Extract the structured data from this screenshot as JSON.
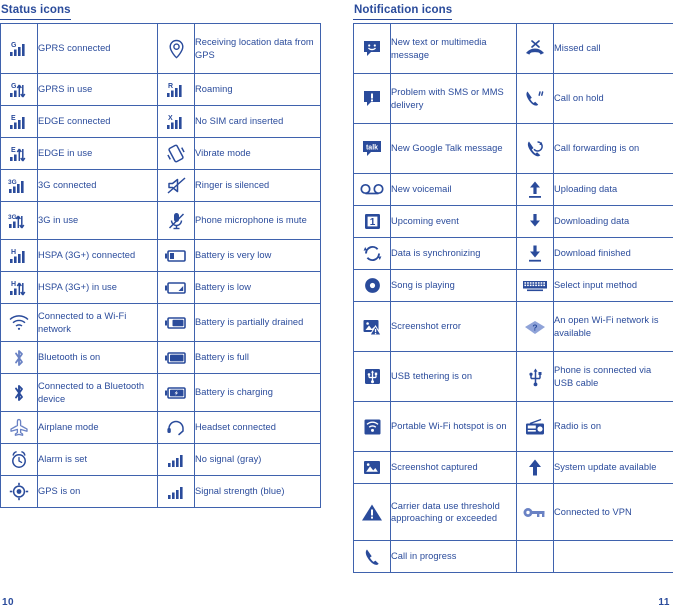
{
  "page": {
    "left_page_number": "10",
    "right_page_number": "11"
  },
  "status_section": {
    "title": "Status icons",
    "rows": [
      {
        "left": {
          "icon": "signal-bars-g-icon",
          "label": "GPRS connected"
        },
        "right": {
          "icon": "location-pin-icon",
          "label": "Receiving location data from GPS"
        }
      },
      {
        "left": {
          "icon": "signal-bars-g-active-icon",
          "label": "GPRS in use"
        },
        "right": {
          "icon": "signal-bars-r-icon",
          "label": "Roaming"
        }
      },
      {
        "left": {
          "icon": "signal-bars-e-icon",
          "label": "EDGE connected"
        },
        "right": {
          "icon": "signal-bars-x-icon",
          "label": "No SIM card inserted"
        }
      },
      {
        "left": {
          "icon": "signal-bars-e-active-icon",
          "label": "EDGE in use"
        },
        "right": {
          "icon": "vibrate-icon",
          "label": "Vibrate mode"
        }
      },
      {
        "left": {
          "icon": "signal-bars-3g-icon",
          "label": "3G connected"
        },
        "right": {
          "icon": "ringer-silenced-icon",
          "label": "Ringer is silenced"
        }
      },
      {
        "left": {
          "icon": "signal-bars-3g-active-icon",
          "label": "3G in use"
        },
        "right": {
          "icon": "microphone-mute-icon",
          "label": "Phone microphone is mute"
        }
      },
      {
        "left": {
          "icon": "signal-bars-h-icon",
          "label": "HSPA (3G+) connected"
        },
        "right": {
          "icon": "battery-very-low-icon",
          "label": "Battery is very low"
        }
      },
      {
        "left": {
          "icon": "signal-bars-h-active-icon",
          "label": "HSPA (3G+) in use"
        },
        "right": {
          "icon": "battery-low-icon",
          "label": "Battery is low"
        }
      },
      {
        "left": {
          "icon": "wifi-connected-icon",
          "label": "Connected to a Wi-Fi network"
        },
        "right": {
          "icon": "battery-partial-icon",
          "label": "Battery is partially drained"
        }
      },
      {
        "left": {
          "icon": "bluetooth-on-icon",
          "label": "Bluetooth is on"
        },
        "right": {
          "icon": "battery-full-icon",
          "label": "Battery is full"
        }
      },
      {
        "left": {
          "icon": "bluetooth-connected-icon",
          "label": "Connected to a Bluetooth device"
        },
        "right": {
          "icon": "battery-charging-icon",
          "label": "Battery is charging"
        }
      },
      {
        "left": {
          "icon": "airplane-mode-icon",
          "label": "Airplane mode"
        },
        "right": {
          "icon": "headset-icon",
          "label": "Headset connected"
        }
      },
      {
        "left": {
          "icon": "alarm-clock-icon",
          "label": "Alarm is set"
        },
        "right": {
          "icon": "signal-no-gray-icon",
          "label": "No signal (gray)"
        }
      },
      {
        "left": {
          "icon": "gps-on-icon",
          "label": "GPS is on"
        },
        "right": {
          "icon": "signal-strength-blue-icon",
          "label": "Signal strength (blue)"
        }
      }
    ]
  },
  "notification_section": {
    "title": "Notification icons",
    "rows": [
      {
        "left": {
          "icon": "sms-message-icon",
          "label": "New text or multimedia message"
        },
        "right": {
          "icon": "missed-call-icon",
          "label": "Missed call"
        }
      },
      {
        "left": {
          "icon": "sms-problem-icon",
          "label": "Problem with SMS or MMS delivery"
        },
        "right": {
          "icon": "call-on-hold-icon",
          "label": "Call on hold"
        }
      },
      {
        "left": {
          "icon": "google-talk-icon",
          "label": "New Google Talk message"
        },
        "right": {
          "icon": "call-forwarding-icon",
          "label": "Call forwarding is on"
        }
      },
      {
        "left": {
          "icon": "voicemail-icon",
          "label": "New voicemail"
        },
        "right": {
          "icon": "upload-icon",
          "label": "Uploading data"
        }
      },
      {
        "left": {
          "icon": "calendar-event-icon",
          "label": "Upcoming event"
        },
        "right": {
          "icon": "download-icon",
          "label": "Downloading data"
        }
      },
      {
        "left": {
          "icon": "sync-icon",
          "label": "Data is synchronizing"
        },
        "right": {
          "icon": "download-finished-icon",
          "label": "Download finished"
        }
      },
      {
        "left": {
          "icon": "music-playing-icon",
          "label": "Song is playing"
        },
        "right": {
          "icon": "keyboard-icon",
          "label": "Select input method"
        }
      },
      {
        "left": {
          "icon": "screenshot-error-icon",
          "label": "Screenshot error"
        },
        "right": {
          "icon": "wifi-open-network-icon",
          "label": "An open Wi-Fi network is available"
        }
      },
      {
        "left": {
          "icon": "usb-tethering-icon",
          "label": "USB tethering is on"
        },
        "right": {
          "icon": "usb-cable-icon",
          "label": "Phone is connected via USB cable"
        }
      },
      {
        "left": {
          "icon": "wifi-hotspot-icon",
          "label": "Portable Wi-Fi hotspot is on"
        },
        "right": {
          "icon": "radio-icon",
          "label": "Radio is on"
        }
      },
      {
        "left": {
          "icon": "screenshot-captured-icon",
          "label": "Screenshot captured"
        },
        "right": {
          "icon": "up-arrow-icon",
          "label": "System update available"
        }
      },
      {
        "left": {
          "icon": "warning-triangle-icon",
          "label": "Carrier data use threshold approaching or exceeded"
        },
        "right": {
          "icon": "vpn-key-icon",
          "label": "Connected to VPN"
        }
      },
      {
        "left": {
          "icon": "call-in-progress-icon",
          "label": "Call in progress"
        },
        "right": {
          "icon": "",
          "label": ""
        }
      }
    ]
  },
  "colors": {
    "text": "#2a4b9b",
    "border": "#3f62ad",
    "icon": "#2a4b9b",
    "icon_muted": "#7b8fd0"
  }
}
